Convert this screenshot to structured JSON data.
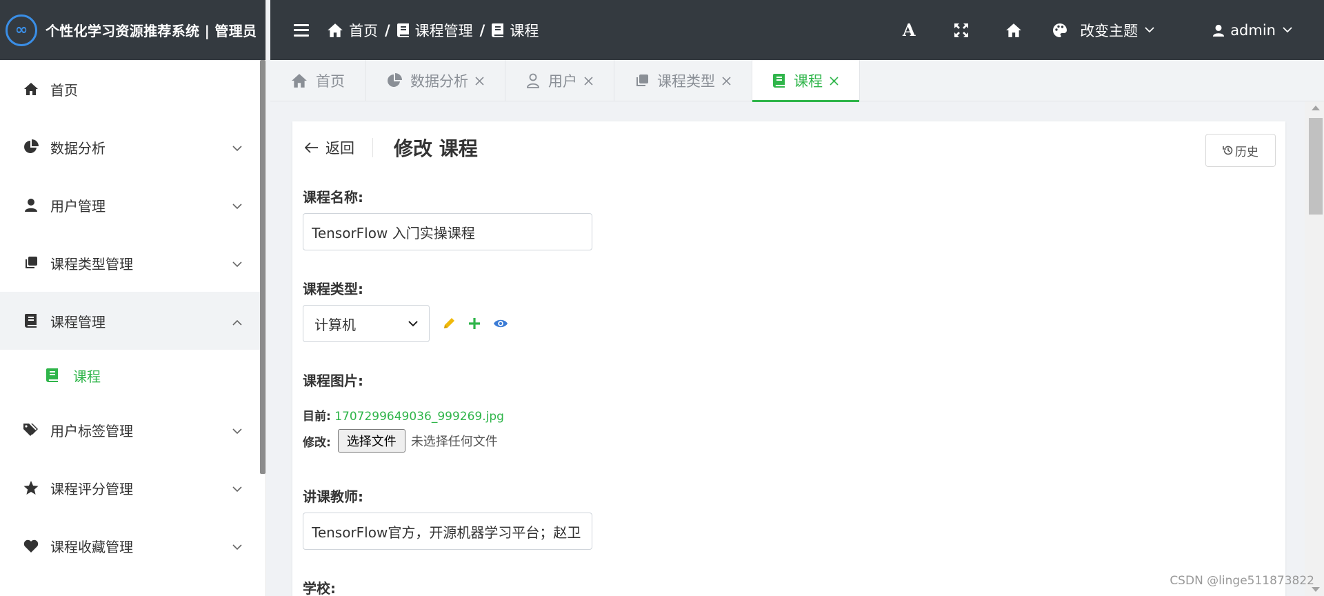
{
  "brand": {
    "title": "个性化学习资源推荐系统 | 管理员",
    "logo": "∞"
  },
  "sidebar": {
    "items": [
      {
        "label": "首页",
        "icon": "home-icon"
      },
      {
        "label": "数据分析",
        "icon": "pie-chart-icon"
      },
      {
        "label": "用户管理",
        "icon": "user-icon"
      },
      {
        "label": "课程类型管理",
        "icon": "copy-icon"
      },
      {
        "label": "课程管理",
        "icon": "book-icon"
      },
      {
        "label": "课程",
        "icon": "book-icon"
      },
      {
        "label": "用户标签管理",
        "icon": "tags-icon"
      },
      {
        "label": "课程评分管理",
        "icon": "star-icon"
      },
      {
        "label": "课程收藏管理",
        "icon": "heart-icon"
      }
    ]
  },
  "topbar": {
    "breadcrumbs": [
      "首页",
      "课程管理",
      "课程"
    ],
    "separator": "/",
    "font_icon": "A",
    "theme_label": "改变主题",
    "user_label": "admin"
  },
  "tabs": [
    {
      "label": "首页",
      "icon": "home-icon"
    },
    {
      "label": "数据分析",
      "icon": "pie-chart-icon"
    },
    {
      "label": "用户",
      "icon": "user-outline-icon"
    },
    {
      "label": "课程类型",
      "icon": "copy-icon"
    },
    {
      "label": "课程",
      "icon": "book-icon"
    }
  ],
  "page": {
    "back_label": "返回",
    "title": "修改 课程",
    "history_label": "历史"
  },
  "form": {
    "course_name": {
      "label": "课程名称:",
      "value": "TensorFlow 入门实操课程"
    },
    "course_type": {
      "label": "课程类型:",
      "selected": "计算机"
    },
    "course_image": {
      "label": "课程图片:",
      "current_label": "目前:",
      "current_file": "1707299649036_999269.jpg",
      "change_label": "修改:",
      "choose_button": "选择文件",
      "no_file": "未选择任何文件"
    },
    "teacher": {
      "label": "讲课教师:",
      "value": "TensorFlow官方，开源机器学习平台；赵卫"
    },
    "school": {
      "label": "学校:"
    }
  },
  "watermark": "CSDN @linge511873822",
  "colors": {
    "accent": "#2fb54a",
    "topbar": "#343a40",
    "edit": "#f0b90b",
    "view": "#3a7bd5"
  }
}
